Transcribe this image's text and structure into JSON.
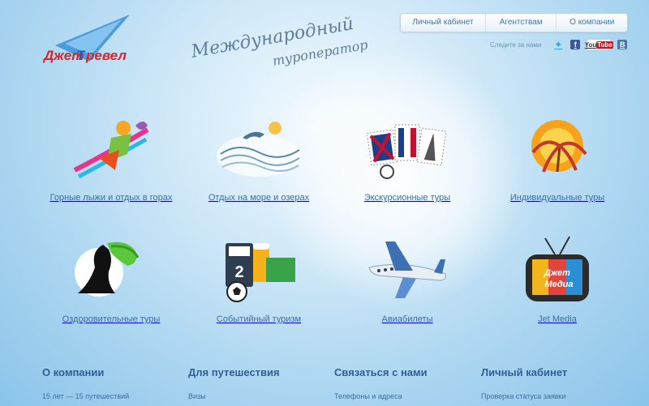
{
  "brand": {
    "logo_text": "ДжетТревел",
    "tagline_line1": "Международный",
    "tagline_line2": "туроператор"
  },
  "topnav": [
    {
      "label": "Личный кабинет"
    },
    {
      "label": "Агентствам"
    },
    {
      "label": "О компании"
    }
  ],
  "social": {
    "follow_label": "Следите за нами",
    "icons": [
      "twitter-icon",
      "facebook-icon",
      "youtube-icon",
      "vkontakte-icon"
    ],
    "youtube_text": "You",
    "youtube_text2": "Tube"
  },
  "categories": [
    {
      "label": "Горные лыжи и отдых в горах",
      "icon": "skier-icon"
    },
    {
      "label": "Отдых на море и озерах",
      "icon": "dolphins-icon"
    },
    {
      "label": "Экскурсионные туры",
      "icon": "stamps-icon"
    },
    {
      "label": "Индивидуальные туры",
      "icon": "sun-palm-icon"
    },
    {
      "label": "Оздоровительные туры",
      "icon": "yoga-icon"
    },
    {
      "label": "Событийный туризм",
      "icon": "beer-football-icon"
    },
    {
      "label": "Авиабилеты",
      "icon": "airplane-icon"
    },
    {
      "label": "Jet Media",
      "icon": "tv-icon",
      "tv_text1": "Джет",
      "tv_text2": "Медиа"
    }
  ],
  "footer": [
    {
      "title": "О компании",
      "link": "15 лет — 15 путешествий"
    },
    {
      "title": "Для путешествия",
      "link": "Визы"
    },
    {
      "title": "Связаться с нами",
      "link": "Телефоны и адреса"
    },
    {
      "title": "Личный кабинет",
      "link": "Проверка статуса заявки"
    }
  ],
  "colors": {
    "accent": "#3a6ea5",
    "heading": "#2f5f94",
    "logo_red": "#d8242a",
    "logo_blue": "#1f5fb0"
  }
}
